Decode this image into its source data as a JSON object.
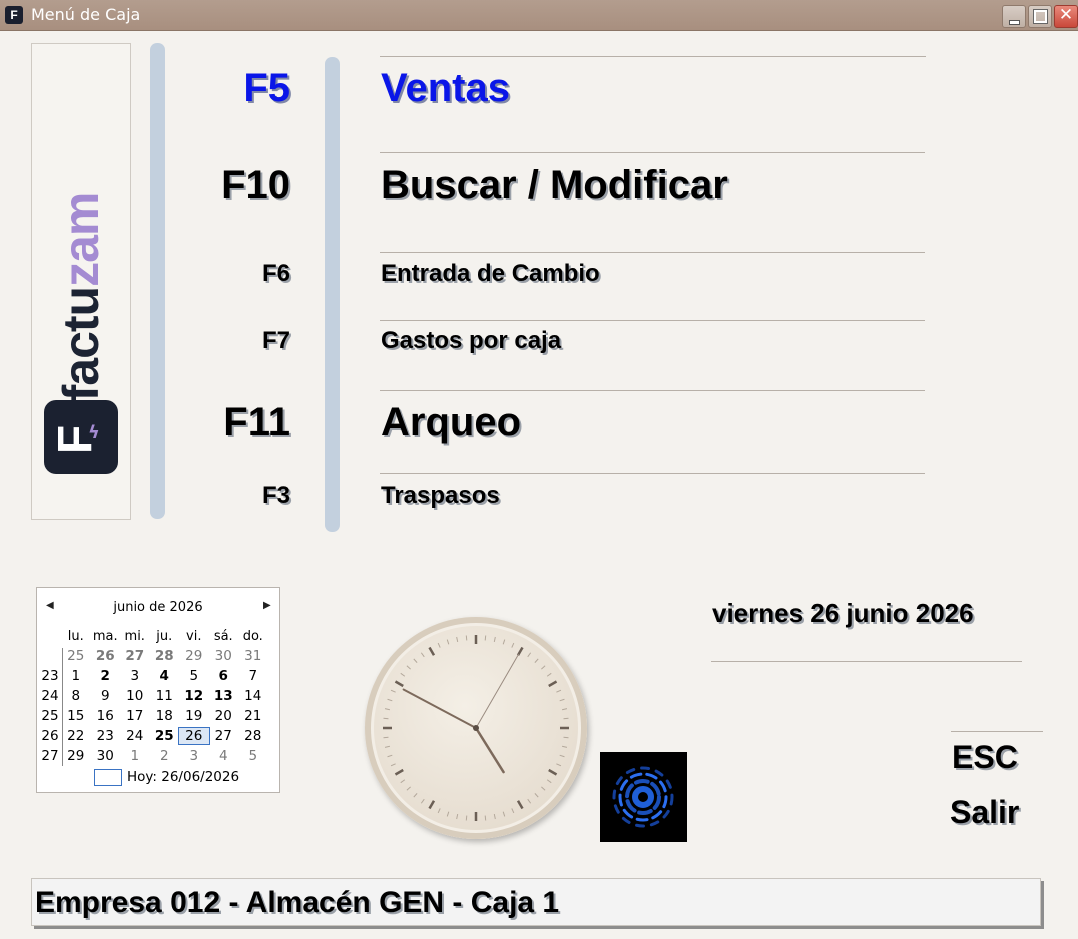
{
  "window": {
    "title": "Menú de Caja",
    "icon": "factuzam-app-icon",
    "icon_letter": "F"
  },
  "logo": {
    "word_part1": "factu",
    "word_part2": "zam",
    "badge_letter": "F",
    "colors": {
      "dark": "#1b2130",
      "accent": "#a48bd2"
    }
  },
  "menu": {
    "items": [
      {
        "key": "F5",
        "label": "Ventas"
      },
      {
        "key": "F10",
        "label": "Buscar / Modificar"
      },
      {
        "key": "F6",
        "label": "Entrada de Cambio"
      },
      {
        "key": "F7",
        "label": "Gastos por caja"
      },
      {
        "key": "F11",
        "label": "Arqueo"
      },
      {
        "key": "F3",
        "label": "Traspasos"
      }
    ],
    "highlight_color": "#0a16e8"
  },
  "calendar": {
    "month_title": "junio de 2026",
    "weekdays": [
      "lu.",
      "ma.",
      "mi.",
      "ju.",
      "vi.",
      "sá.",
      "do."
    ],
    "weeks": [
      {
        "wk": "",
        "days": [
          "25",
          "26",
          "27",
          "28",
          "29",
          "30",
          "31"
        ]
      },
      {
        "wk": "23",
        "days": [
          "1",
          "2",
          "3",
          "4",
          "5",
          "6",
          "7"
        ]
      },
      {
        "wk": "24",
        "days": [
          "8",
          "9",
          "10",
          "11",
          "12",
          "13",
          "14"
        ]
      },
      {
        "wk": "25",
        "days": [
          "15",
          "16",
          "17",
          "18",
          "19",
          "20",
          "21"
        ]
      },
      {
        "wk": "26",
        "days": [
          "22",
          "23",
          "24",
          "25",
          "26",
          "27",
          "28"
        ]
      },
      {
        "wk": "27",
        "days": [
          "29",
          "30",
          "1",
          "2",
          "3",
          "4",
          "5"
        ]
      }
    ],
    "today_text": "Hoy: 26/06/2026",
    "selected_day": "26"
  },
  "date_text": "viernes 26 junio 2026",
  "exit": {
    "key": "ESC",
    "label": "Salir"
  },
  "status": "Empresa 012 - Almacén GEN - Caja 1"
}
